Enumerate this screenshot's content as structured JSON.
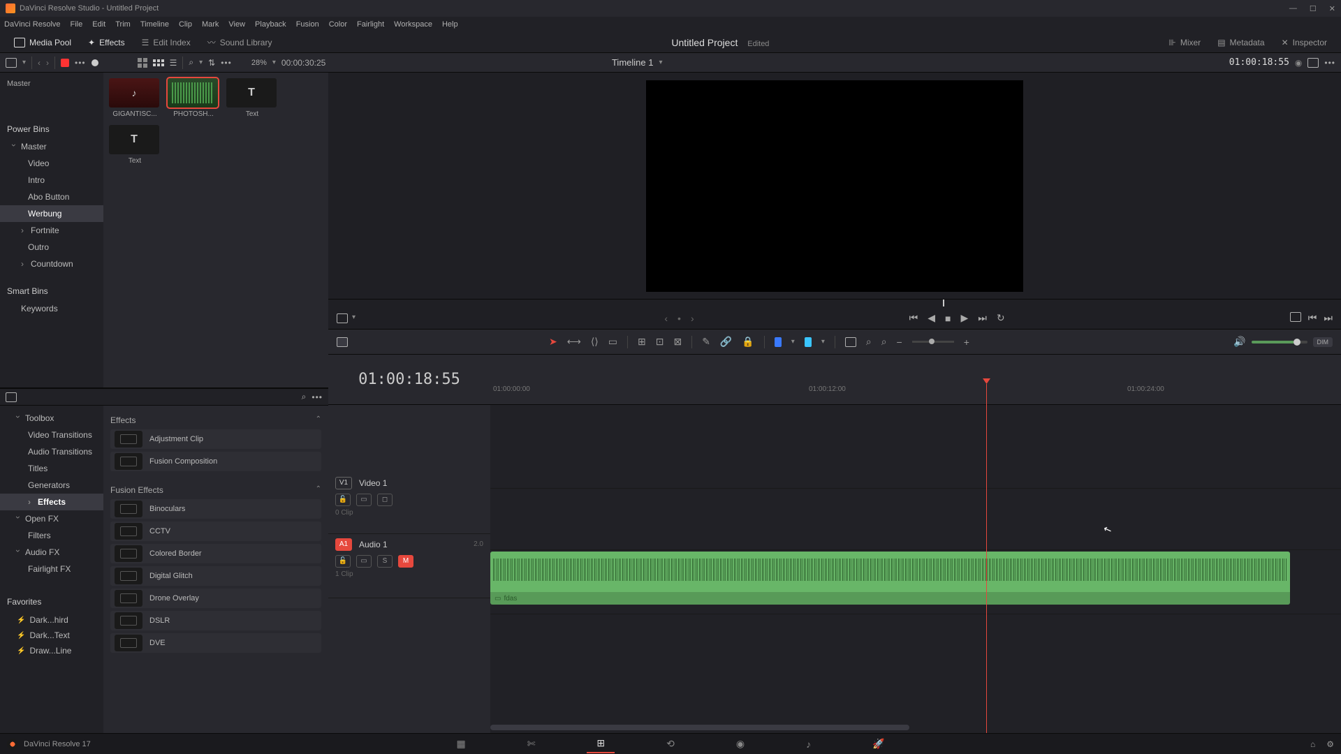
{
  "titlebar": {
    "app": "DaVinci Resolve Studio",
    "project": "Untitled Project"
  },
  "menubar": [
    "DaVinci Resolve",
    "File",
    "Edit",
    "Trim",
    "Timeline",
    "Clip",
    "Mark",
    "View",
    "Playback",
    "Fusion",
    "Color",
    "Fairlight",
    "Workspace",
    "Help"
  ],
  "topbar": {
    "mediaPool": "Media Pool",
    "effects": "Effects",
    "editIndex": "Edit Index",
    "soundLibrary": "Sound Library",
    "projectName": "Untitled Project",
    "edited": "Edited",
    "mixer": "Mixer",
    "metadata": "Metadata",
    "inspector": "Inspector"
  },
  "toolbar2": {
    "zoom": "28%",
    "duration": "00:00:30:25",
    "timelineName": "Timeline 1",
    "timecode": "01:00:18:55"
  },
  "bins": {
    "masterHeader": "Master",
    "powerBins": "Power Bins",
    "master": "Master",
    "items": [
      "Video",
      "Intro",
      "Abo Button",
      "Werbung"
    ],
    "collapsible": [
      "Fortnite",
      "Outro",
      "Countdown"
    ],
    "smartBins": "Smart Bins",
    "keywords": "Keywords"
  },
  "thumbs": [
    {
      "label": "GIGANTISC...",
      "kind": "audio"
    },
    {
      "label": "PHOTOSH...",
      "kind": "wave"
    },
    {
      "label": "Text",
      "kind": "text"
    },
    {
      "label": "Text",
      "kind": "text"
    }
  ],
  "fxSidebar": {
    "toolbox": "Toolbox",
    "toolboxItems": [
      "Video Transitions",
      "Audio Transitions",
      "Titles",
      "Generators",
      "Effects"
    ],
    "openFx": "Open FX",
    "filters": "Filters",
    "audioFx": "Audio FX",
    "fairlight": "Fairlight FX",
    "favorites": "Favorites",
    "favItems": [
      "Dark...hird",
      "Dark...Text",
      "Draw...Line"
    ]
  },
  "fxList": {
    "cat1": "Effects",
    "catItems1": [
      "Adjustment Clip",
      "Fusion Composition"
    ],
    "cat2": "Fusion Effects",
    "catItems2": [
      "Binoculars",
      "CCTV",
      "Colored Border",
      "Digital Glitch",
      "Drone Overlay",
      "DSLR",
      "DVE"
    ]
  },
  "timeline": {
    "tc": "01:00:18:55",
    "ruler": [
      "01:00:00:00",
      "01:00:12:00",
      "01:00:24:00"
    ],
    "video": {
      "badge": "V1",
      "name": "Video 1",
      "clips": "0 Clip"
    },
    "audio": {
      "badge": "A1",
      "name": "Audio 1",
      "ch": "2.0",
      "clips": "1 Clip",
      "clipName": "fdas",
      "solo": "S",
      "mute": "M"
    }
  },
  "editToolbar": {
    "dim": "DIM"
  },
  "bottom": {
    "version": "DaVinci Resolve 17"
  }
}
